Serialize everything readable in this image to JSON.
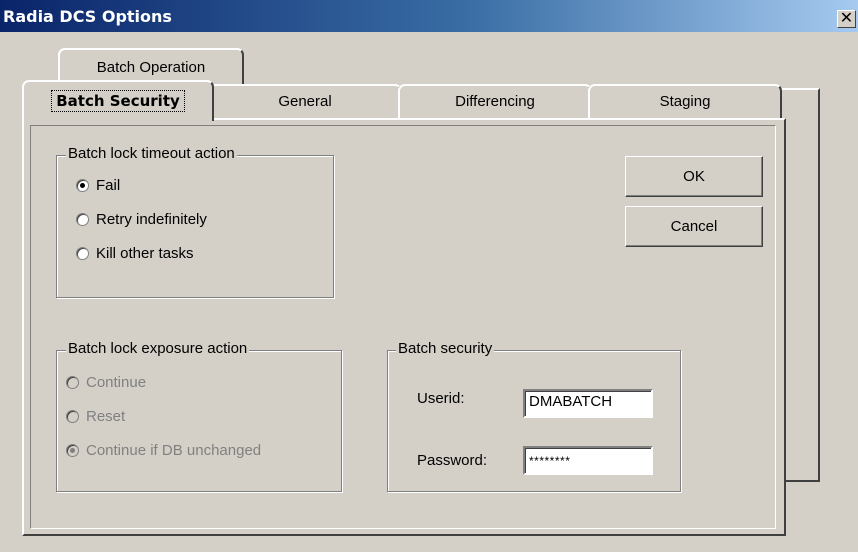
{
  "window": {
    "title": "Radia DCS Options",
    "close_glyph": "✕"
  },
  "tabs": {
    "back_row": [
      "Batch Operation"
    ],
    "front_row": [
      "Batch Security",
      "General",
      "Differencing",
      "Staging"
    ],
    "active": "Batch Security"
  },
  "lock_timeout": {
    "label": "Batch lock timeout action",
    "options": [
      "Fail",
      "Retry indefinitely",
      "Kill other tasks"
    ],
    "selected": "Fail"
  },
  "lock_exposure": {
    "label": "Batch lock exposure action",
    "options": [
      "Continue",
      "Reset",
      "Continue if DB unchanged"
    ],
    "selected": "Continue if DB unchanged",
    "disabled": true
  },
  "security": {
    "label": "Batch security",
    "userid_label": "Userid:",
    "userid_value": "DMABATCH",
    "password_label": "Password:",
    "password_value": "********"
  },
  "buttons": {
    "ok": "OK",
    "cancel": "Cancel"
  },
  "icons": {
    "close": "close-icon",
    "radio": "radio-icon"
  },
  "colors": {
    "titlebar": "#0a246a",
    "face": "#d4d0c8"
  }
}
